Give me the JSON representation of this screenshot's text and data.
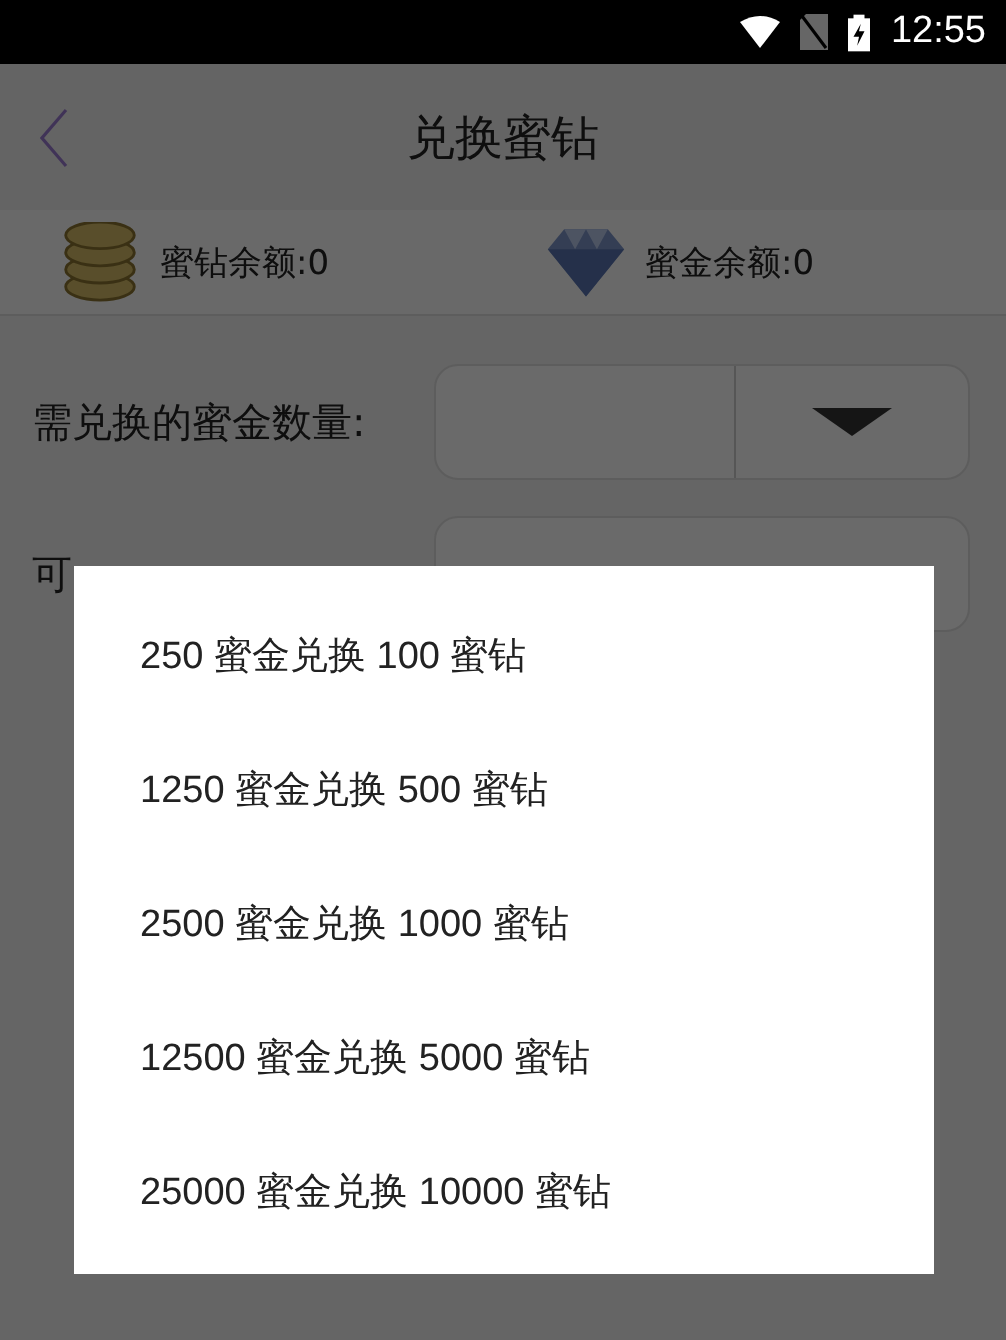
{
  "status_bar": {
    "time": "12:55"
  },
  "header": {
    "title": "兑换蜜钻"
  },
  "balances": [
    {
      "kind": "coins",
      "label": "蜜钻余额:0"
    },
    {
      "kind": "diamond",
      "label": "蜜金余额:0"
    }
  ],
  "form": [
    {
      "label": "需兑换的蜜金数量:",
      "kind": "dropdown"
    },
    {
      "label": "可",
      "kind": "input"
    }
  ],
  "dialog": {
    "options": [
      "250 蜜金兑换 100 蜜钻",
      "1250 蜜金兑换 500 蜜钻",
      "2500 蜜金兑换 1000 蜜钻",
      "12500 蜜金兑换 5000 蜜钻",
      "25000 蜜金兑换 10000 蜜钻"
    ]
  }
}
